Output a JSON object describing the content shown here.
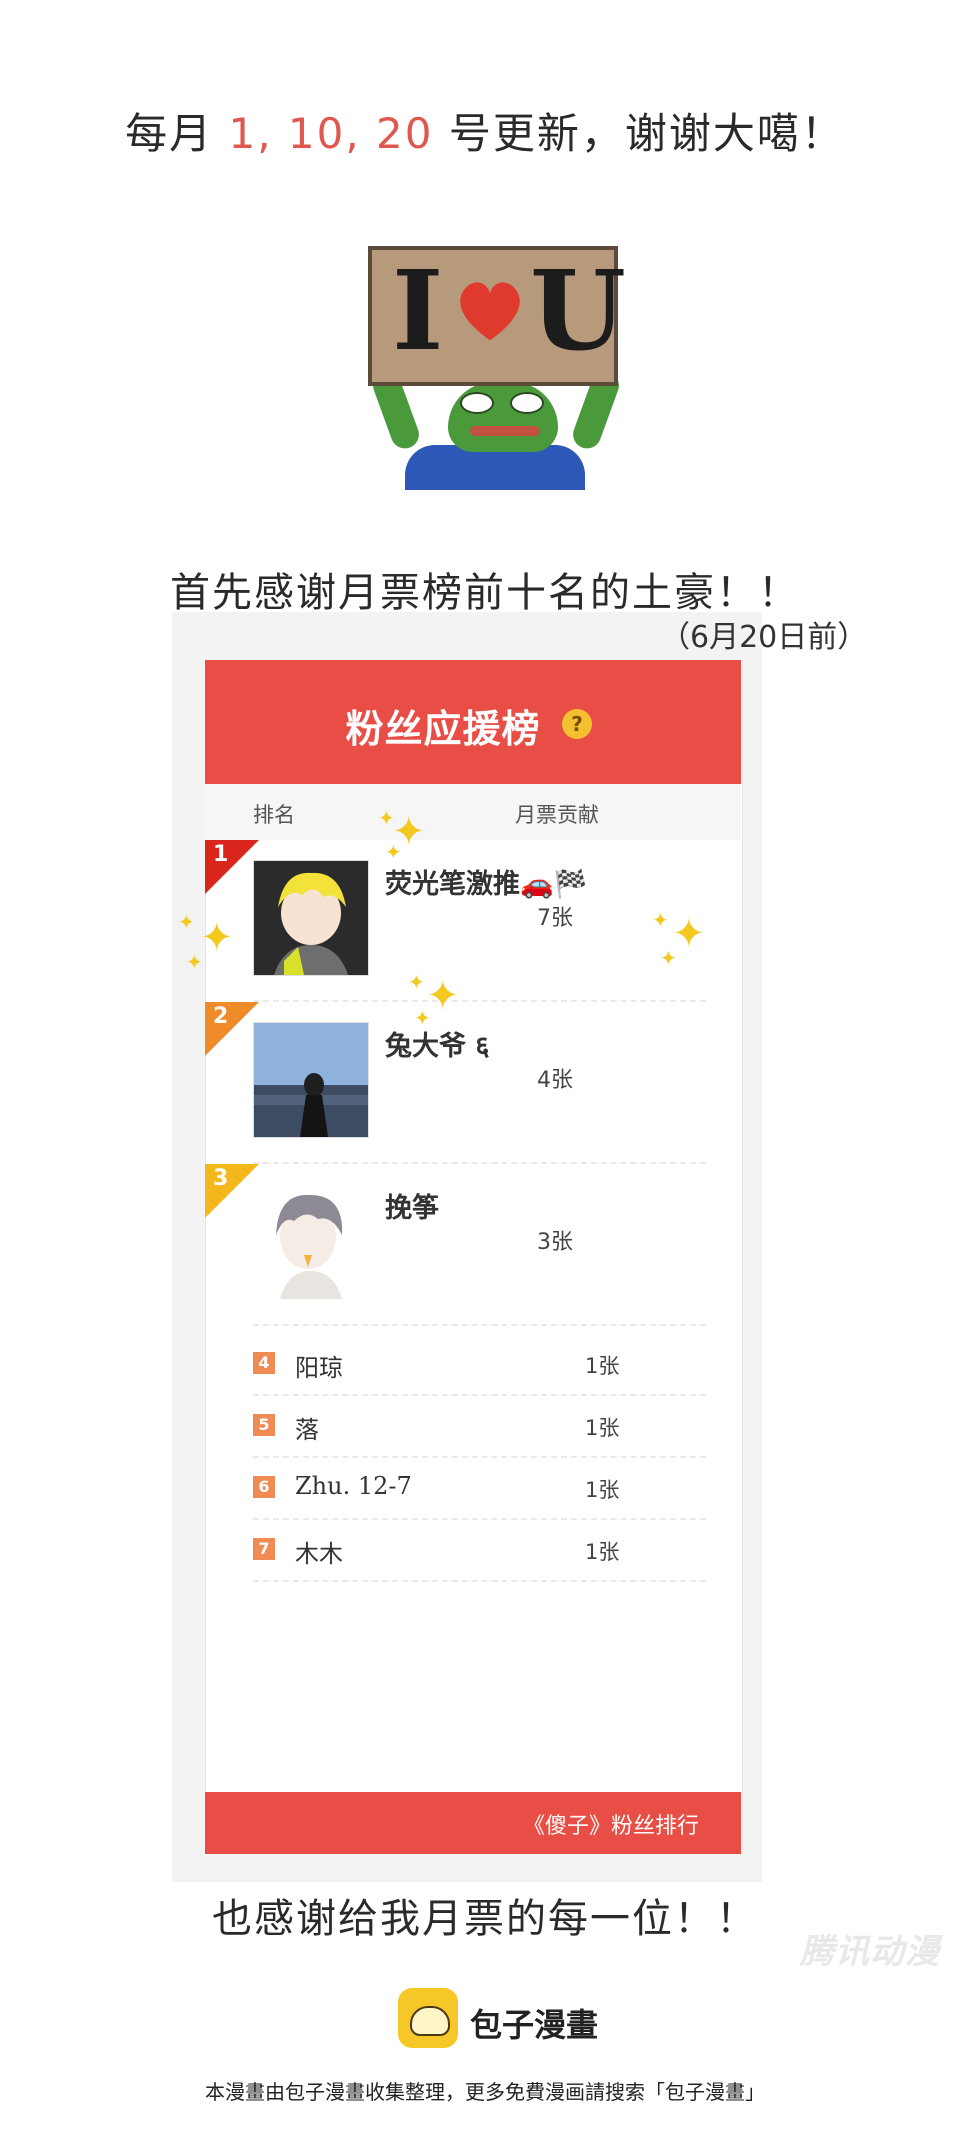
{
  "header": {
    "prefix": "每月 ",
    "dates": "1, 10, 20",
    "suffix": " 号更新，谢谢大噶！",
    "highlight_color": "#e0574f"
  },
  "meme": {
    "sign_left": "I",
    "sign_right": "U"
  },
  "thanks_top": "首先感谢月票榜前十名的土豪！！",
  "date_note": "（6月20日前）",
  "leaderboard": {
    "title": "粉丝应援榜",
    "help_icon": "?",
    "col_rank": "排名",
    "col_votes": "月票贡献",
    "top": [
      {
        "rank": "1",
        "name": "荧光笔激推🚗🏁",
        "count": "7张",
        "flag_color": "#d9261c"
      },
      {
        "rank": "2",
        "name": "兔大爷 ६",
        "count": "4张",
        "flag_color": "#f08b2a"
      },
      {
        "rank": "3",
        "name": "挽筝",
        "count": "3张",
        "flag_color": "#f5b81c"
      }
    ],
    "rest": [
      {
        "rank": "4",
        "name": "阳琼",
        "count": "1张"
      },
      {
        "rank": "5",
        "name": "落",
        "count": "1张"
      },
      {
        "rank": "6",
        "name": "Zhu. 12-7",
        "count": "1张"
      },
      {
        "rank": "7",
        "name": "木木",
        "count": "1张"
      }
    ],
    "footer": "《傻子》粉丝排行",
    "brand_color": "#e84e45"
  },
  "thanks_bottom": "也感谢给我月票的每一位！！",
  "watermark": "腾讯动漫",
  "logo_text": "包子漫畫",
  "footer_note": "本漫畫由包子漫畫收集整理，更多免費漫画請搜索「包子漫畫」",
  "icons": [
    "heart-icon",
    "sparkle-icon",
    "help-icon",
    "bun-logo-icon"
  ]
}
